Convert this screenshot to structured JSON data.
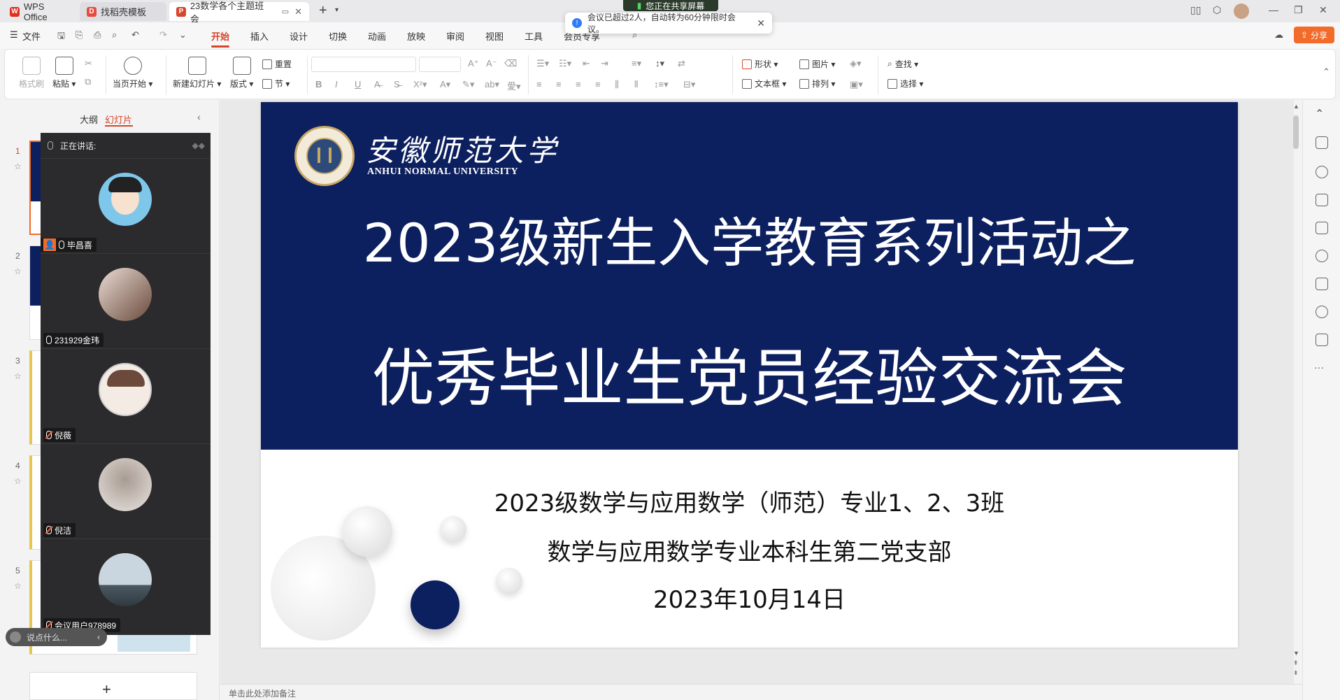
{
  "tabs": [
    {
      "label": "WPS Office",
      "icon": "wps-logo-icon"
    },
    {
      "label": "找稻壳模板",
      "icon": "docer-icon"
    },
    {
      "label": "23数学各个主题班会",
      "icon": "ppt-icon",
      "active": true
    }
  ],
  "sharing_banner": "您正在共享屏幕",
  "notice": {
    "text": "会议已超过2人，自动转为60分钟限时会议。"
  },
  "menu": {
    "file": "文件",
    "items": [
      "开始",
      "插入",
      "设计",
      "切换",
      "动画",
      "放映",
      "审阅",
      "视图",
      "工具",
      "会员专享"
    ],
    "active": "开始",
    "share": "分享"
  },
  "ribbon": {
    "format_painter": "格式刷",
    "paste": "粘贴",
    "from_current": "当页开始",
    "new_slide": "新建幻灯片",
    "layout": "版式",
    "reset": "重置",
    "section": "节",
    "shape": "形状",
    "picture": "图片",
    "textbox": "文本框",
    "arrange": "排列",
    "find": "查找",
    "select": "选择"
  },
  "left_panel": {
    "tab_outline": "大纲",
    "tab_slides": "幻灯片",
    "slide_numbers": [
      "1",
      "2",
      "3",
      "4",
      "5"
    ],
    "add": "+"
  },
  "participants": {
    "header": "正在讲话:",
    "people": [
      {
        "name": "毕昌喜",
        "mic": "on",
        "host": true
      },
      {
        "name": "231929金玮",
        "mic": "on"
      },
      {
        "name": "倪薇",
        "mic": "off"
      },
      {
        "name": "倪洁",
        "mic": "off"
      },
      {
        "name": "会议用户978989",
        "mic": "off"
      }
    ]
  },
  "comment_placeholder": "说点什么...",
  "slide": {
    "university_cn": "安徽师范大学",
    "university_en": "ANHUI NORMAL UNIVERSITY",
    "title_line1": "2023级新生入学教育系列活动之",
    "title_line2": "优秀毕业生党员经验交流会",
    "sub1": "2023级数学与应用数学（师范）专业1、2、3班",
    "sub2": "数学与应用数学专业本科生第二党支部",
    "sub3": "2023年10月14日",
    "navy": "#0c1f5e"
  },
  "notes_placeholder": "单击此处添加备注",
  "colors": {
    "accent": "#d6462b",
    "share_btn": "#f26b2a"
  }
}
